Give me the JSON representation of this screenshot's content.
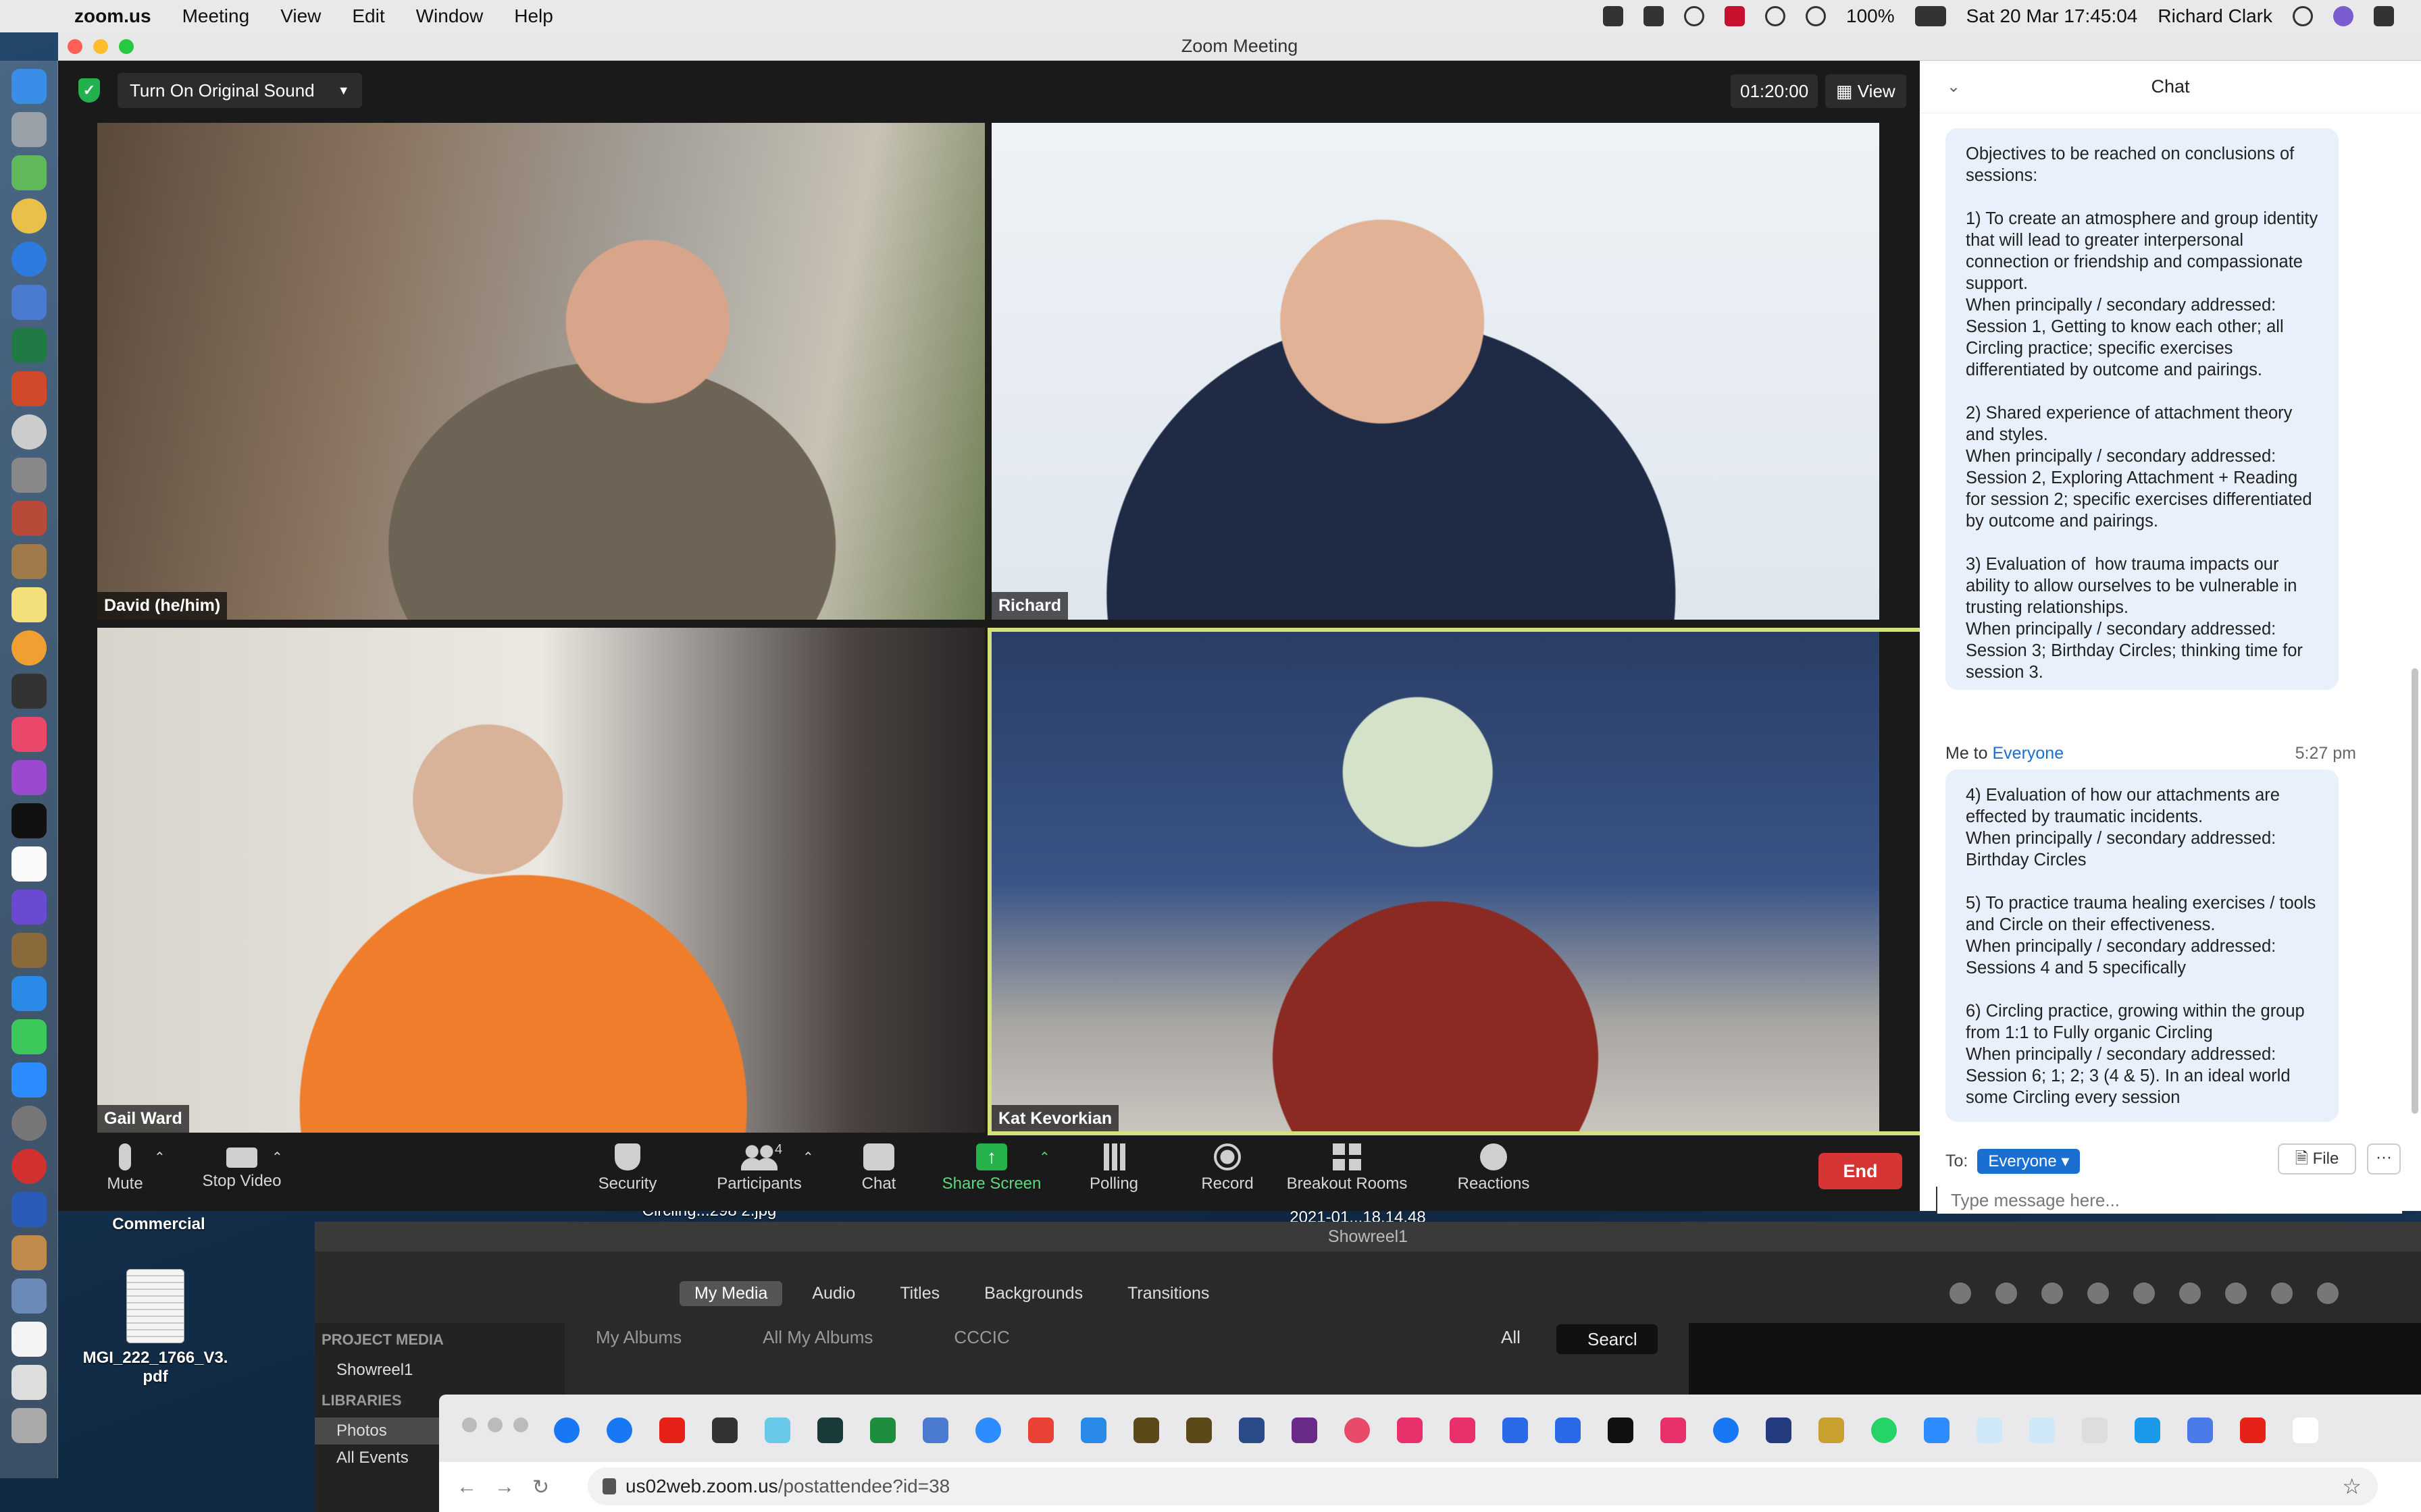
{
  "menubar": {
    "app_name": "zoom.us",
    "items": [
      "Meeting",
      "View",
      "Edit",
      "Window",
      "Help"
    ],
    "battery": "100%",
    "datetime": "Sat 20 Mar  17:45:04",
    "user": "Richard Clark"
  },
  "window": {
    "title": "Zoom Meeting"
  },
  "meeting": {
    "original_sound_label": "Turn On Original Sound",
    "timer": "01:20:00",
    "view_label": "View",
    "participants": [
      {
        "name": "David (he/him)"
      },
      {
        "name": "Richard"
      },
      {
        "name": "Gail Ward"
      },
      {
        "name": "Kat Kevorkian"
      }
    ],
    "toolbar": {
      "mute": "Mute",
      "stop_video": "Stop Video",
      "security": "Security",
      "participants": "Participants",
      "participants_count": "4",
      "chat": "Chat",
      "share_screen": "Share Screen",
      "polling": "Polling",
      "record": "Record",
      "breakout_rooms": "Breakout Rooms",
      "reactions": "Reactions",
      "end": "End"
    }
  },
  "chat": {
    "title": "Chat",
    "message1": "Objectives to be reached on conclusions of sessions:\n\n1) To create an atmosphere and group identity that will lead to greater interpersonal connection or friendship and compassionate support.\nWhen principally / secondary addressed: Session 1, Getting to know each other; all Circling practice; specific exercises differentiated by outcome and pairings.\n\n2) Shared experience of attachment theory and styles.\nWhen principally / secondary addressed: Session 2, Exploring Attachment + Reading for session 2; specific exercises differentiated by outcome and pairings.\n\n3) Evaluation of  how trauma impacts our ability to allow ourselves to be vulnerable in trusting relationships.\nWhen principally / secondary addressed: Session 3; Birthday Circles; thinking time for session 3.",
    "sender_prefix": "Me to",
    "sender_target": "Everyone",
    "time": "5:27 pm",
    "message2": "4) Evaluation of how our attachments are effected by traumatic incidents.\nWhen principally / secondary addressed: Birthday Circles\n\n5) To practice trauma healing exercises / tools and Circle on their effectiveness.\nWhen principally / secondary addressed: Sessions 4 and 5 specifically\n\n6) Circling practice, growing within the group from 1:1 to Fully organic Circling\nWhen principally / secondary addressed: Session 6; 1; 2; 3 (4 & 5). In an ideal world some Circling every session",
    "to_label": "To:",
    "to_value": "Everyone",
    "file_label": "File",
    "more_label": "···",
    "input_placeholder": "Type message here..."
  },
  "desktop": {
    "item1": "Commercial",
    "item2_line1": "MGI_222_1766_V3.",
    "item2_line2": "pdf",
    "file_label": "Circling...298 2.jpg",
    "file_label2": "2021-01...18.14.48"
  },
  "imovie": {
    "title": "Showreel1",
    "tabs": [
      "My Media",
      "Audio",
      "Titles",
      "Backgrounds",
      "Transitions"
    ],
    "project_media": "PROJECT MEDIA",
    "project_item": "Showreel1",
    "libraries": "LIBRARIES",
    "library_photos": "Photos",
    "library_events": "All Events",
    "albums": [
      "My Albums",
      "All My Albums",
      "CCCIC"
    ],
    "filter": "All",
    "search": "Searcl"
  },
  "browser": {
    "url_domain": "us02web.zoom.us",
    "url_path": "/postattendee?id=38"
  },
  "colors": {
    "accent_blue": "#1a6fd1",
    "end_red": "#d63535",
    "share_green": "#25b14b",
    "active_speaker": "#d4e07a"
  }
}
